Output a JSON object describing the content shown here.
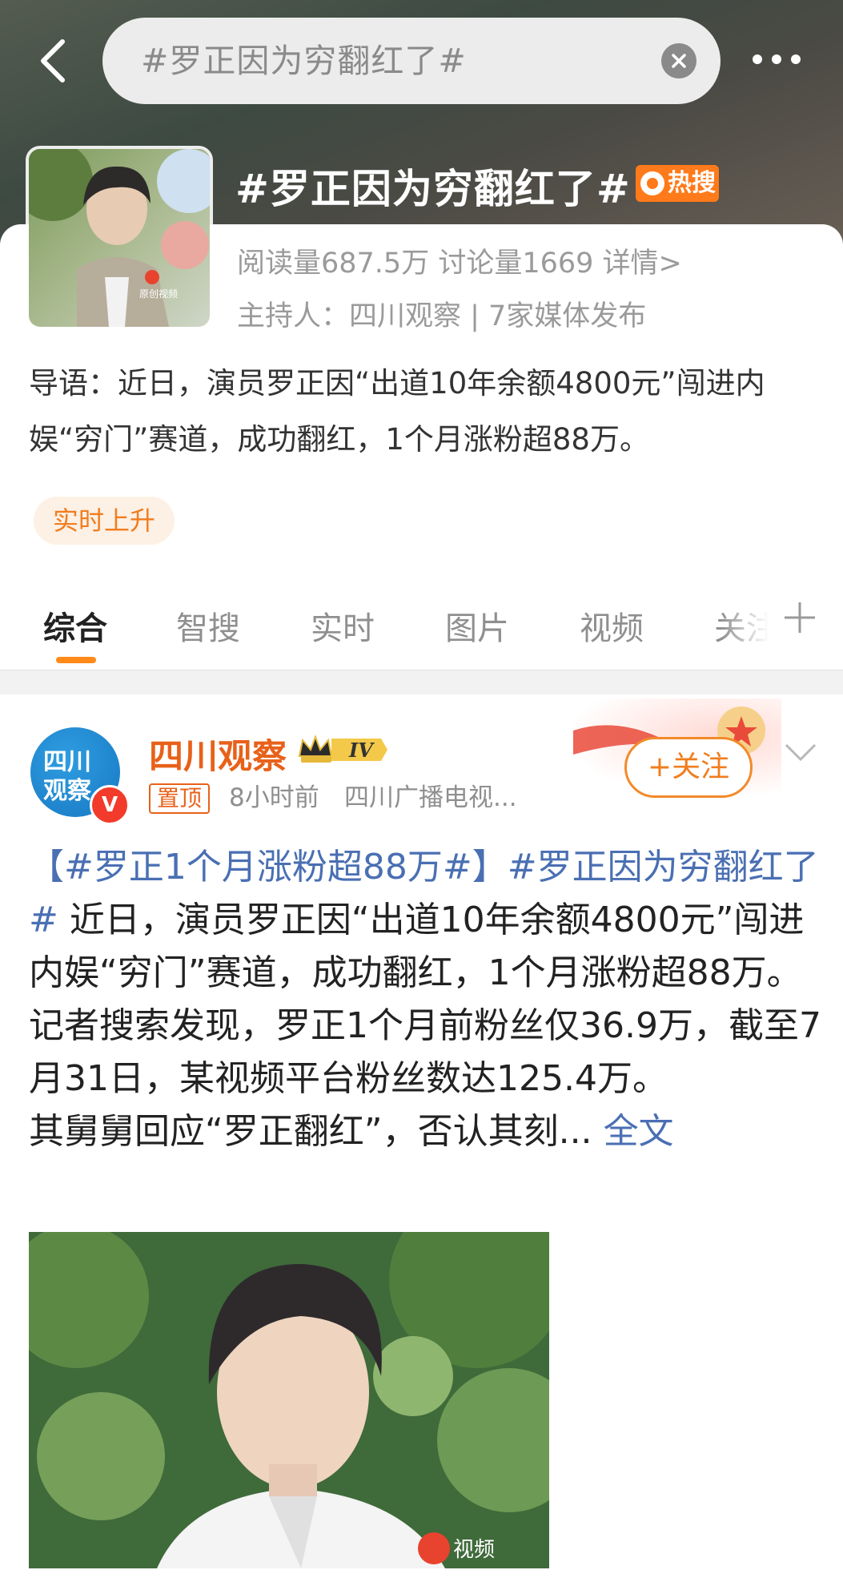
{
  "header": {
    "search_text": "#罗正因为穷翻红了#",
    "topic_title": "#罗正因为穷翻红了#",
    "hot_badge": "热搜",
    "stats": "阅读量687.5万  讨论量1669  详情>",
    "host": "主持人：四川观察 | 7家媒体发布",
    "thumb_caption": "原创视频"
  },
  "intro": "导语：近日，演员罗正因“出道10年余额4800元”闯进内娱“穷门”赛道，成功翻红，1个月涨粉超88万。",
  "rising_badge": "实时上升",
  "tabs": [
    "综合",
    "智搜",
    "实时",
    "图片",
    "视频",
    "关注"
  ],
  "active_tab": "综合",
  "post": {
    "avatar_line1": "四川",
    "avatar_line2": "观察",
    "author": "四川观察",
    "level": "IV",
    "pinned": "置顶",
    "time": "8小时前",
    "source": "四川广播电视...",
    "follow": "+关注",
    "hashtag1": "【#罗正1个月涨粉超88万#】",
    "hashtag2": "#罗正因为穷翻红了#",
    "body": " 近日，演员罗正因“出道10年余额4800元”闯进内娱“穷门”赛道，成功翻红，1个月涨粉超88万。记者搜索发现，罗正1个月前粉丝仅36.9万，截至7月31日，某视频平台粉丝数达125.4万。",
    "body2": "其舅舅回应“罗正翻红”，否认其刻...",
    "full_text": "全文",
    "photo_watermark": "视频"
  },
  "colors": {
    "accent": "#ff8a1a",
    "author": "#e8611a",
    "link": "#4a6fb3"
  }
}
